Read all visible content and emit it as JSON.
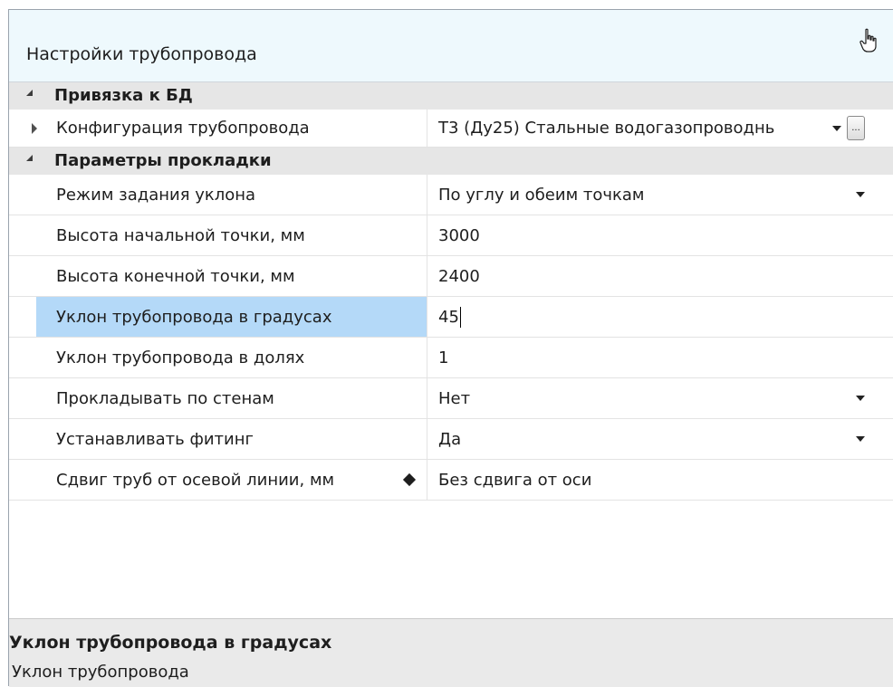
{
  "window": {
    "title": "Настройки трубопровода"
  },
  "categories": [
    {
      "label": "Привязка к БД",
      "rows": [
        {
          "name": "Конфигурация трубопровода",
          "value": "Т3 (Ду25) Стальные водогазопроводнь",
          "control": "dropdown+ellipsis",
          "ellipsis_label": "..."
        }
      ]
    },
    {
      "label": "Параметры прокладки",
      "rows": [
        {
          "name": "Режим задания уклона",
          "value": "По углу и обеим точкам",
          "control": "dropdown"
        },
        {
          "name": "Высота начальной точки, мм",
          "value": "3000",
          "control": "text"
        },
        {
          "name": "Высота конечной точки, мм",
          "value": "2400",
          "control": "text"
        },
        {
          "name": "Уклон трубопровода в градусах",
          "value": "45",
          "control": "text",
          "selected": true
        },
        {
          "name": "Уклон трубопровода в долях",
          "value": "1",
          "control": "text"
        },
        {
          "name": "Прокладывать по стенам",
          "value": "Нет",
          "control": "dropdown"
        },
        {
          "name": "Устанавливать фитинг",
          "value": "Да",
          "control": "dropdown"
        },
        {
          "name": "Сдвиг труб от осевой линии, мм",
          "value": "Без сдвига от оси",
          "control": "diamond"
        }
      ]
    }
  ],
  "description": {
    "title": "Уклон трубопровода в градусах",
    "text": "Уклон трубопровода"
  },
  "colors": {
    "titlebar_bg": "#eef9fd",
    "category_bg": "#e6e6e6",
    "selected_bg": "#b4d9f8",
    "description_bg": "#eaeaea"
  },
  "icons": [
    "pointer-hand-icon",
    "collapse-triangle-icon",
    "expand-triangle-icon",
    "dropdown-arrow-icon",
    "ellipsis-button",
    "diamond-marker-icon"
  ]
}
